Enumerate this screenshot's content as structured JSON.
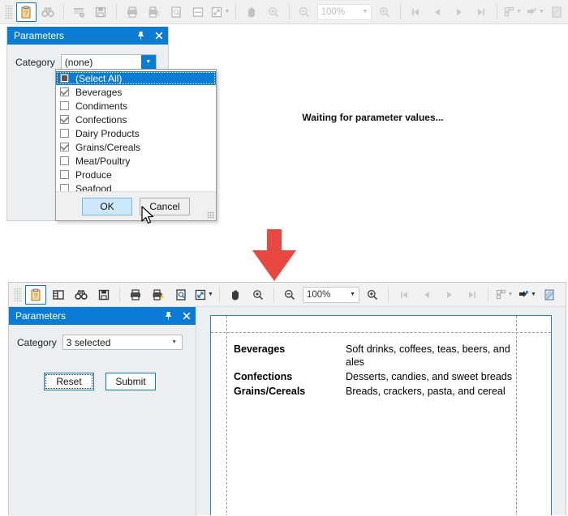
{
  "toolbar_top": {
    "items": [
      {
        "name": "parameters-panel-toggle",
        "icon": "clipboard-icon",
        "state": "active"
      },
      {
        "name": "find-button",
        "icon": "binoculars-icon",
        "state": "disabled"
      },
      {
        "name": "refresh-data-button",
        "icon": "table-refresh-icon",
        "state": "disabled"
      },
      {
        "name": "save-button",
        "icon": "floppy-disk-icon",
        "state": "disabled"
      },
      {
        "name": "print-button",
        "icon": "printer-icon",
        "state": "disabled"
      },
      {
        "name": "quick-print-button",
        "icon": "printer-lightning-icon",
        "state": "disabled"
      },
      {
        "name": "page-setup-button",
        "icon": "page-magnifier-icon",
        "state": "disabled"
      },
      {
        "name": "scale-button",
        "icon": "page-split-icon",
        "state": "disabled"
      },
      {
        "name": "zoom-to-fit-button",
        "icon": "diagonal-arrows-icon",
        "state": "disabled",
        "caret": true
      },
      {
        "name": "hand-tool-button",
        "icon": "hand-icon",
        "state": "disabled"
      },
      {
        "name": "magnifier-tool-button",
        "icon": "magnifier-icon",
        "state": "disabled"
      },
      {
        "name": "zoom-out-button",
        "icon": "zoom-out-icon",
        "state": "disabled"
      },
      {
        "name": "zoom-combo",
        "icon": "zoom-value",
        "state": "disabled"
      },
      {
        "name": "zoom-in-button",
        "icon": "zoom-in-icon",
        "state": "disabled"
      },
      {
        "name": "first-page-button",
        "icon": "first-page-icon",
        "state": "disabled"
      },
      {
        "name": "previous-page-button",
        "icon": "previous-page-icon",
        "state": "disabled"
      },
      {
        "name": "next-page-button",
        "icon": "next-page-icon",
        "state": "disabled"
      },
      {
        "name": "last-page-button",
        "icon": "last-page-icon",
        "state": "disabled"
      },
      {
        "name": "multipage-view-button",
        "icon": "multipage-icon",
        "state": "disabled",
        "caret": true
      },
      {
        "name": "export-document-button",
        "icon": "export-icon",
        "state": "disabled",
        "caret": true
      },
      {
        "name": "watermark-button",
        "icon": "watermark-page-icon",
        "state": "disabled"
      }
    ],
    "zoom_value": "100%"
  },
  "toolbar_bottom": {
    "items": [
      {
        "name": "parameters-panel-toggle",
        "icon": "clipboard-icon",
        "state": "active"
      },
      {
        "name": "document-map-button",
        "icon": "panel-layout-icon",
        "state": "enabled"
      },
      {
        "name": "find-button",
        "icon": "binoculars-icon",
        "state": "enabled"
      },
      {
        "name": "save-button",
        "icon": "floppy-disk-icon",
        "state": "enabled"
      },
      {
        "name": "print-button",
        "icon": "printer-icon",
        "state": "enabled"
      },
      {
        "name": "quick-print-button",
        "icon": "printer-lightning-icon",
        "state": "enabled"
      },
      {
        "name": "page-setup-button",
        "icon": "page-magnifier-icon",
        "state": "enabled"
      },
      {
        "name": "zoom-to-fit-button",
        "icon": "diagonal-arrows-icon",
        "state": "enabled",
        "caret": true
      },
      {
        "name": "hand-tool-button",
        "icon": "hand-icon",
        "state": "enabled"
      },
      {
        "name": "magnifier-tool-button",
        "icon": "magnifier-icon",
        "state": "enabled"
      },
      {
        "name": "zoom-out-button",
        "icon": "zoom-out-icon",
        "state": "enabled"
      },
      {
        "name": "zoom-combo",
        "icon": "zoom-value",
        "state": "enabled"
      },
      {
        "name": "zoom-in-button",
        "icon": "zoom-in-icon",
        "state": "enabled"
      },
      {
        "name": "first-page-button",
        "icon": "first-page-icon",
        "state": "disabled"
      },
      {
        "name": "previous-page-button",
        "icon": "previous-page-icon",
        "state": "disabled"
      },
      {
        "name": "next-page-button",
        "icon": "next-page-icon",
        "state": "disabled"
      },
      {
        "name": "last-page-button",
        "icon": "last-page-icon",
        "state": "disabled"
      },
      {
        "name": "multipage-view-button",
        "icon": "multipage-icon",
        "state": "disabled",
        "caret": true
      },
      {
        "name": "export-document-button",
        "icon": "export-icon",
        "state": "enabled",
        "caret": true
      },
      {
        "name": "watermark-button",
        "icon": "watermark-page-icon",
        "state": "enabled"
      }
    ],
    "zoom_value": "100%"
  },
  "panel_top": {
    "title": "Parameters",
    "pin_icon": "pin-icon",
    "close_icon": "close-icon",
    "category_label": "Category",
    "category_value": "(none)"
  },
  "panel_bottom": {
    "title": "Parameters",
    "pin_icon": "pin-icon",
    "close_icon": "close-icon",
    "category_label": "Category",
    "category_value": "3 selected",
    "reset_label": "Reset",
    "submit_label": "Submit"
  },
  "dropdown": {
    "items": [
      {
        "label": "(Select All)",
        "state": "indeterminate",
        "selected": true
      },
      {
        "label": "Beverages",
        "state": "checked",
        "selected": false
      },
      {
        "label": "Condiments",
        "state": "unchecked",
        "selected": false
      },
      {
        "label": "Confections",
        "state": "checked",
        "selected": false
      },
      {
        "label": "Dairy Products",
        "state": "unchecked",
        "selected": false
      },
      {
        "label": "Grains/Cereals",
        "state": "checked",
        "selected": false
      },
      {
        "label": "Meat/Poultry",
        "state": "unchecked",
        "selected": false
      },
      {
        "label": "Produce",
        "state": "unchecked",
        "selected": false
      },
      {
        "label": "Seafood",
        "state": "unchecked",
        "selected": false
      }
    ],
    "ok_label": "OK",
    "cancel_label": "Cancel"
  },
  "document_top": {
    "status_message": "Waiting for parameter values..."
  },
  "report": {
    "rows": [
      {
        "category": "Beverages",
        "description": "Soft drinks, coffees, teas, beers, and ales"
      },
      {
        "category": "Confections",
        "description": "Desserts, candies, and sweet breads"
      },
      {
        "category": "Grains/Cereals",
        "description": "Breads, crackers, pasta, and cereal"
      }
    ]
  },
  "annotation": {
    "arrow_icon": "down-arrow-icon",
    "arrow_color": "#e8483f"
  }
}
